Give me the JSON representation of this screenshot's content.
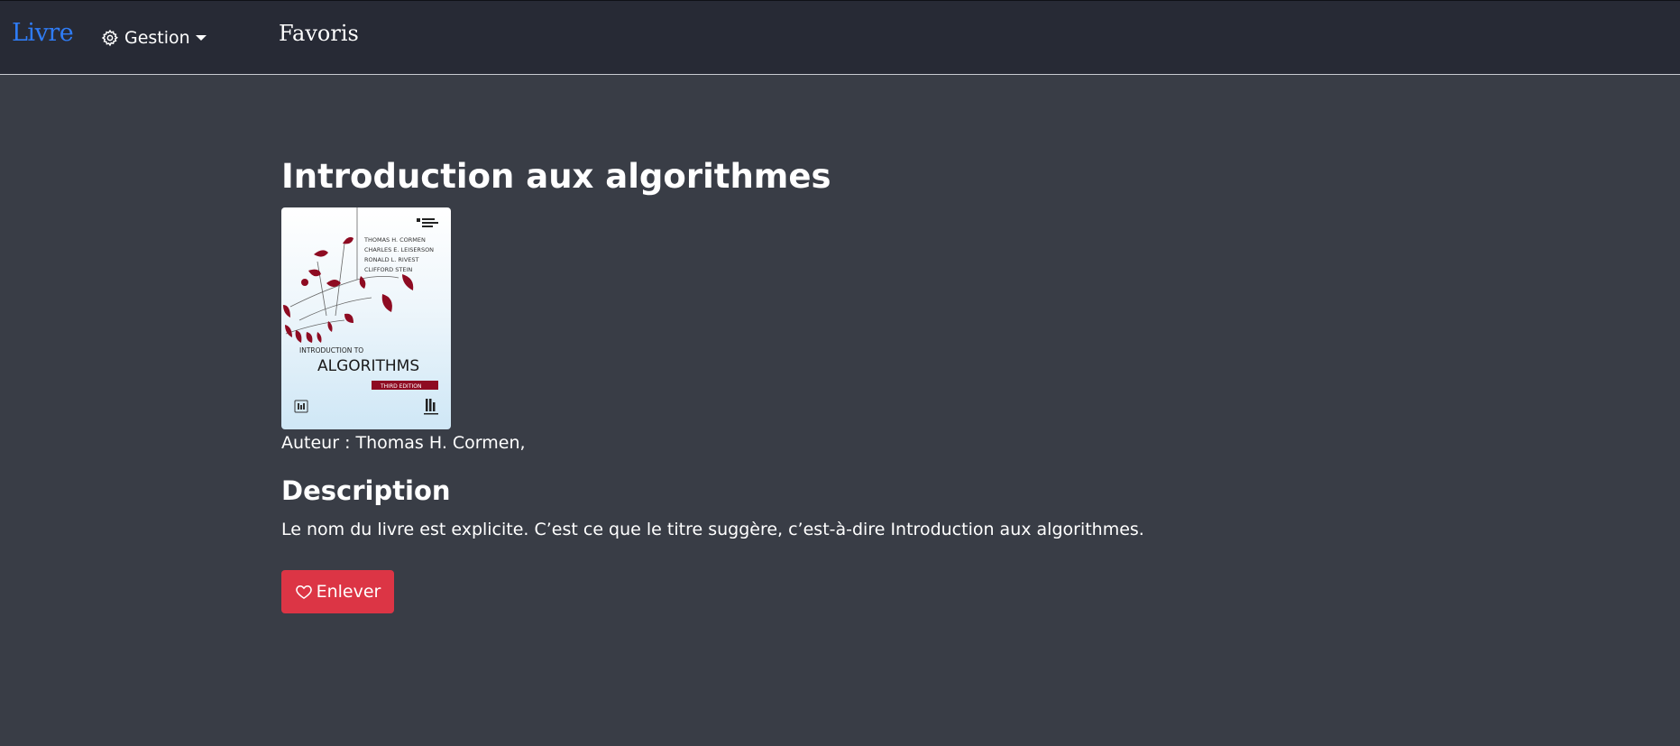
{
  "navbar": {
    "brand": "Livre",
    "gestion": "Gestion",
    "favoris": "Favoris"
  },
  "book": {
    "title": "Introduction aux algorithmes",
    "author_line": "Auteur : Thomas H. Cormen,",
    "description_heading": "Description",
    "description": "Le nom du livre est explicite. C’est ce que le titre suggère, c’est-à-dire Introduction aux algorithmes.",
    "remove_button": "Enlever",
    "cover": {
      "authors": [
        "THOMAS H. CORMEN",
        "CHARLES E. LEISERSON",
        "RONALD L. RIVEST",
        "CLIFFORD STEIN"
      ],
      "intro": "INTRODUCTION TO",
      "main": "ALGORITHMS",
      "edition": "THIRD  EDITION"
    }
  },
  "colors": {
    "accent": "#2f7cf6",
    "danger": "#dc3545",
    "background": "#393d46",
    "navbar": "#272a35"
  },
  "icons": [
    "gear-icon",
    "chevron-down-icon",
    "heart-icon"
  ]
}
